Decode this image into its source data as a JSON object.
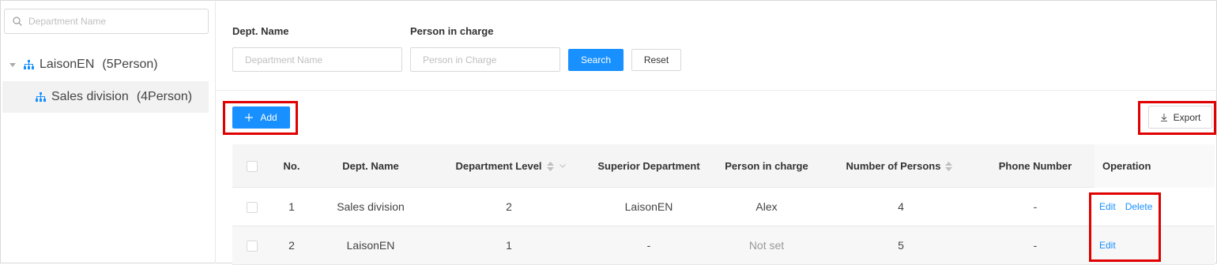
{
  "sidebar": {
    "search_placeholder": "Department Name",
    "tree": [
      {
        "label": "LaisonEN",
        "count": "(5Person)"
      },
      {
        "label": "Sales division",
        "count": "(4Person)"
      }
    ]
  },
  "filters": {
    "dept_label": "Dept. Name",
    "dept_placeholder": "Department Name",
    "person_label": "Person in charge",
    "person_placeholder": "Person in Charge",
    "search_label": "Search",
    "reset_label": "Reset"
  },
  "toolbar": {
    "add_label": "Add",
    "export_label": "Export"
  },
  "table": {
    "headers": {
      "no": "No.",
      "dept_name": "Dept. Name",
      "level": "Department Level",
      "superior": "Superior Department",
      "person": "Person in charge",
      "persons": "Number of Persons",
      "phone": "Phone Number",
      "operation": "Operation"
    },
    "rows": [
      {
        "no": "1",
        "dept_name": "Sales division",
        "level": "2",
        "superior": "LaisonEN",
        "person": "Alex",
        "persons": "4",
        "phone": "-",
        "edit": "Edit",
        "delete": "Delete"
      },
      {
        "no": "2",
        "dept_name": "LaisonEN",
        "level": "1",
        "superior": "-",
        "person": "Not set",
        "persons": "5",
        "phone": "-",
        "edit": "Edit"
      }
    ]
  },
  "colors": {
    "primary": "#1890ff",
    "highlight": "#e00000"
  }
}
